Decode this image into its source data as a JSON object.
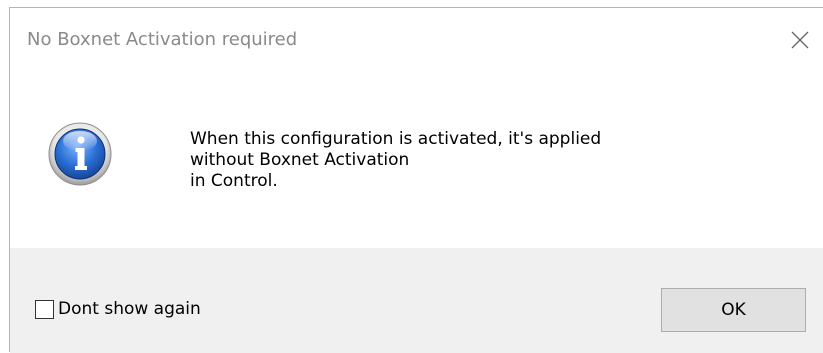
{
  "dialog": {
    "title": "No Boxnet Activation required",
    "close_icon": "close-icon",
    "info_icon": "info-icon",
    "message_lines": [
      "When this configuration is activated, it's applied",
      "without Boxnet Activation",
      "in Control."
    ],
    "checkbox": {
      "label": "Dont show again",
      "checked": false
    },
    "ok_label": "OK"
  },
  "colors": {
    "title_text": "#8a8a8a",
    "footer_bg": "#f0f0f0",
    "button_bg": "#e1e1e1",
    "button_border": "#adadad",
    "icon_blue": "#1f5fbf"
  }
}
